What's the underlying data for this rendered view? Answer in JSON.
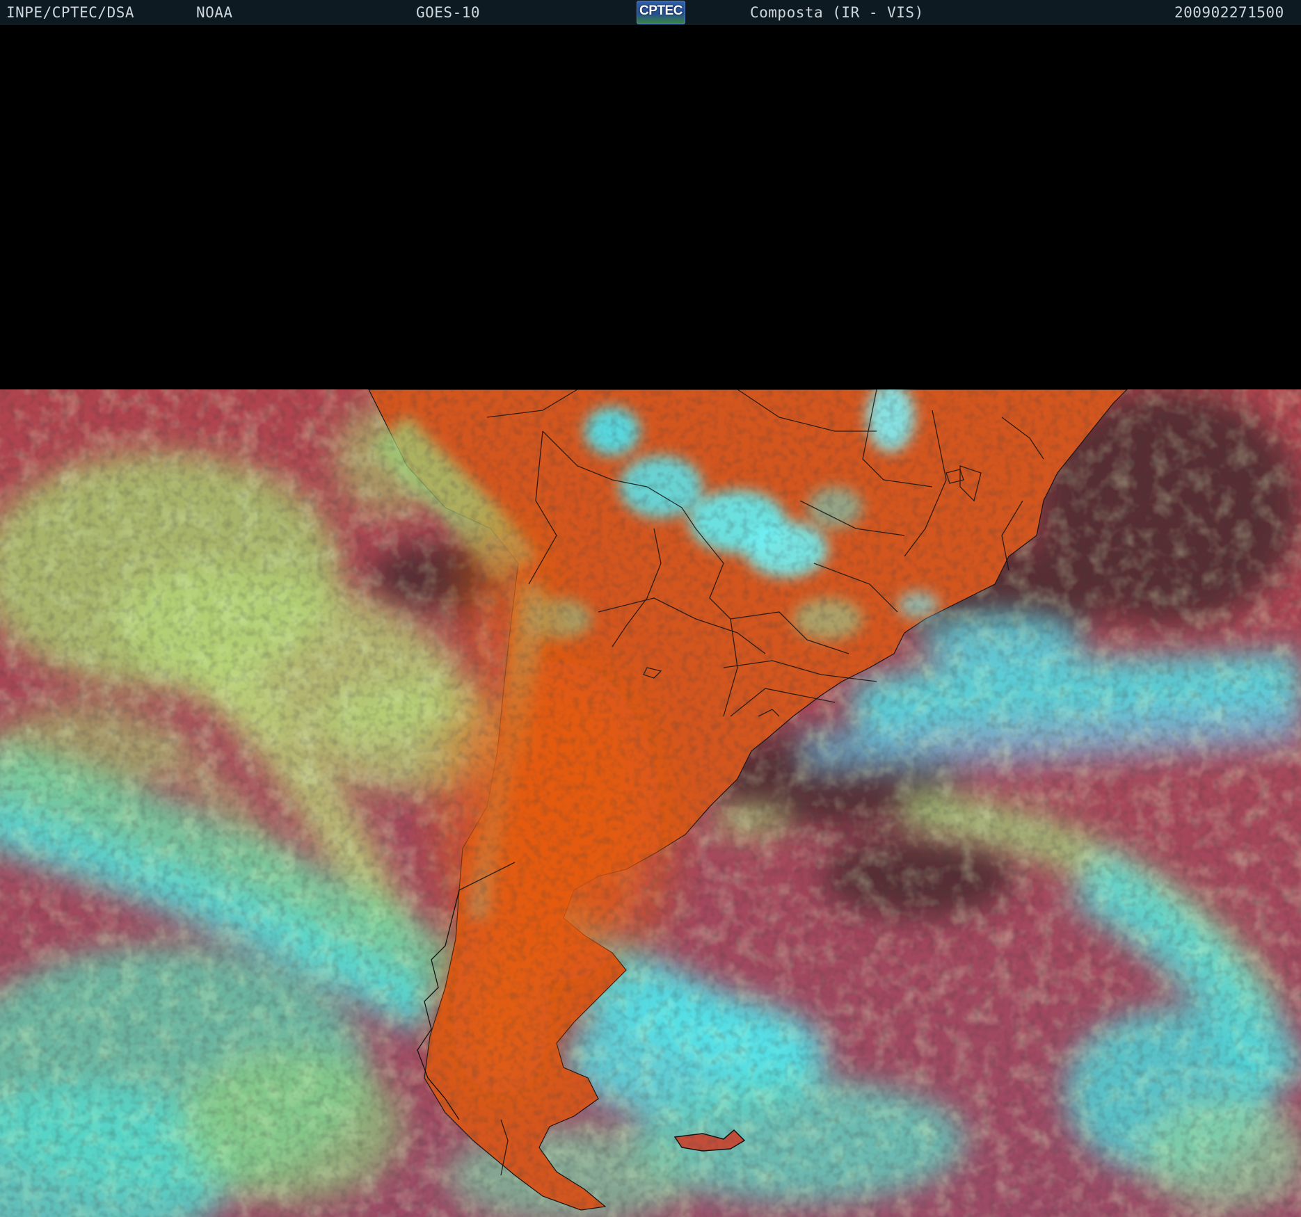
{
  "header": {
    "source": "INPE/CPTEC/DSA",
    "agency": "NOAA",
    "satellite": "GOES-10",
    "logo_text": "CPTEC",
    "product": "Composta (IR - VIS)",
    "timestamp": "200902271500"
  },
  "colors": {
    "header_bg": "#0d1a22",
    "space": "#000000",
    "ocean_clear": "#a9454f",
    "land_clear": "#d9581f",
    "low_cloud": "#9ad86a",
    "high_cloud": "#3fe6ee",
    "borders": "#111111"
  }
}
